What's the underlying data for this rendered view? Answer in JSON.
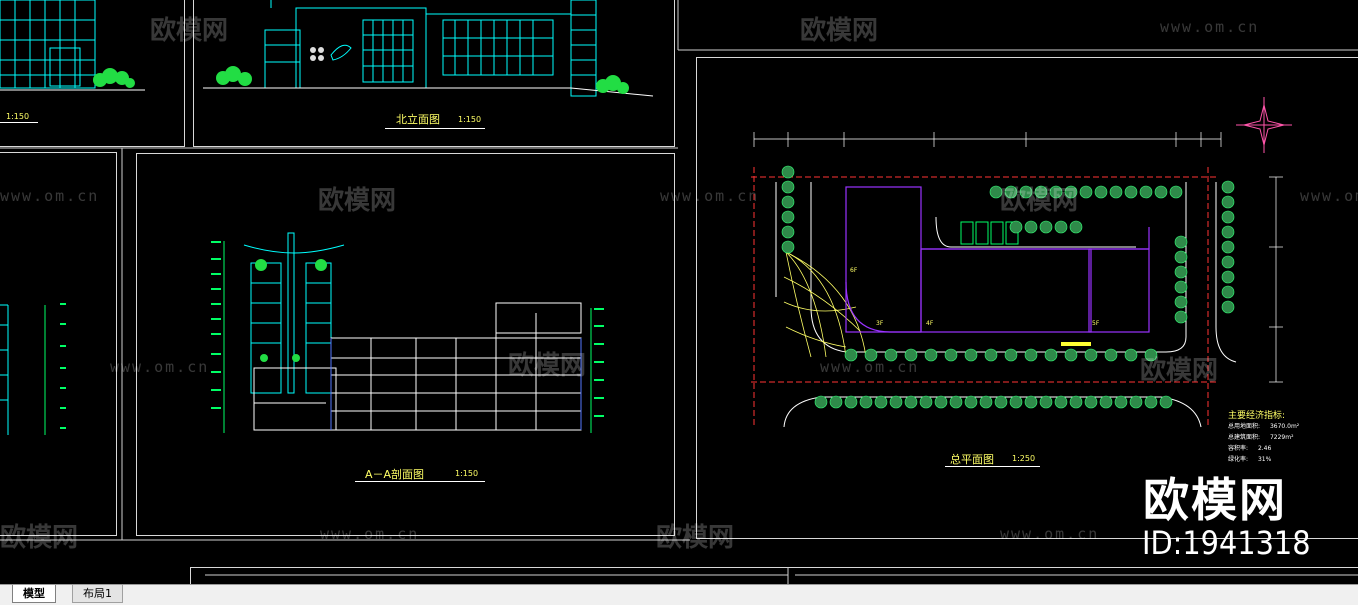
{
  "drawings": {
    "north_elevation": {
      "title": "北立面图",
      "scale": "1:150"
    },
    "left_top": {
      "scale": "1:150"
    },
    "section": {
      "title": "A－A剖面图",
      "scale": "1:150"
    },
    "site_plan": {
      "title": "总平面图",
      "scale": "1:250",
      "floor_labels": [
        "6F",
        "3F",
        "4F",
        "5F"
      ],
      "stats_title": "主要经济指标:",
      "stats": [
        {
          "label": "总用地面积:",
          "value": "3670.0m²"
        },
        {
          "label": "总建筑面积:",
          "value": "7229m²"
        },
        {
          "label": "容积率:",
          "value": "2.46"
        },
        {
          "label": "绿化率:",
          "value": "31%"
        }
      ]
    }
  },
  "watermarks": {
    "brand": "欧模网",
    "url": "www.om.cn",
    "id_text": "ID:1941318"
  },
  "tabs": [
    {
      "label": "模型",
      "active": true
    },
    {
      "label": "布局1",
      "active": false
    }
  ],
  "colors": {
    "background": "#000000",
    "cyan": "#00ffff",
    "green": "#00ff66",
    "yellow": "#ffff66",
    "blue": "#5577ff",
    "purple": "#9933ff",
    "red": "#ff3333"
  }
}
